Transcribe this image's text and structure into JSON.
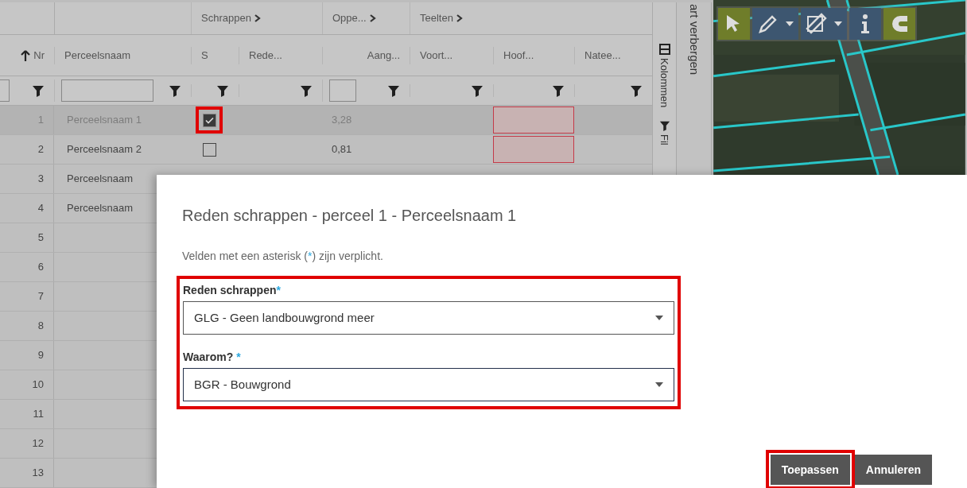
{
  "table": {
    "column_groups": [
      {
        "columns": [
          {
            "label": "Nr",
            "sorted": true,
            "filter_input": true
          },
          {
            "label": "Perceelsnaam",
            "sorted": false,
            "filter_input": true
          }
        ]
      },
      {
        "label": "Schrappen",
        "columns": [
          {
            "label": "S",
            "sorted": false,
            "filter_input": false
          },
          {
            "label": "Rede...",
            "sorted": false,
            "filter_input": false
          }
        ]
      },
      {
        "label": "Oppe...",
        "columns": [
          {
            "label": "Aang...",
            "sorted": false,
            "filter_input": true
          }
        ]
      },
      {
        "label": "Teelten",
        "columns": [
          {
            "label": "Voort...",
            "sorted": false,
            "filter_input": false
          },
          {
            "label": "Hoof...",
            "sorted": false,
            "filter_input": false
          },
          {
            "label": "Natee...",
            "sorted": false,
            "filter_input": false
          }
        ]
      }
    ]
  },
  "rows": [
    {
      "nr": "1",
      "name": "Perceelsnaam 1",
      "selected": true,
      "checked": true,
      "checkbox_highlighted": true,
      "area": "3,28",
      "invalid": true
    },
    {
      "nr": "2",
      "name": "Perceelsnaam 2",
      "selected": false,
      "checked": false,
      "checkbox_highlighted": false,
      "area": "0,81",
      "invalid": true
    },
    {
      "nr": "3",
      "name": "Perceelsnaam",
      "selected": false
    },
    {
      "nr": "4",
      "name": "Perceelsnaam",
      "selected": false
    },
    {
      "nr": "5",
      "selected": false
    },
    {
      "nr": "6",
      "selected": false
    },
    {
      "nr": "7",
      "selected": false
    },
    {
      "nr": "8",
      "selected": false
    },
    {
      "nr": "9",
      "selected": false
    },
    {
      "nr": "10",
      "selected": false
    },
    {
      "nr": "11",
      "selected": false
    },
    {
      "nr": "12",
      "selected": false
    },
    {
      "nr": "13",
      "selected": false
    }
  ],
  "side_tabs": [
    {
      "kind": "columns",
      "label": "Kolommen"
    },
    {
      "kind": "filter",
      "label": "Fil"
    }
  ],
  "map_toggle": {
    "label": "art verbergen"
  },
  "map_tools": [
    {
      "kind": "pointer",
      "color": "#6f7d2a",
      "dropdown": false
    },
    {
      "kind": "pencil",
      "color": "#3d5670",
      "dropdown": true
    },
    {
      "kind": "ruler",
      "color": "#3d5670",
      "dropdown": true
    },
    {
      "kind": "info",
      "color": "#3d5670",
      "dropdown": false
    },
    {
      "kind": "magnet",
      "color": "#6f7d2a",
      "dropdown": false
    }
  ],
  "dialog": {
    "title": "Reden schrappen - perceel 1 - Perceelsnaam 1",
    "hint": {
      "before": "Velden met een asterisk (",
      "mark": "*",
      "after": ") zijn verplicht."
    },
    "fields_highlighted": true,
    "fields": [
      {
        "label": "Reden schrappen",
        "required_mark": "*",
        "value": "GLG - Geen landbouwgrond meer",
        "focused": false
      },
      {
        "label": "Waarom?",
        "required_mark": "*",
        "value": "BGR - Bouwgrond",
        "focused": true
      }
    ],
    "buttons": [
      {
        "label": "Toepassen",
        "highlighted": true
      },
      {
        "label": "Annuleren",
        "highlighted": false
      }
    ]
  }
}
